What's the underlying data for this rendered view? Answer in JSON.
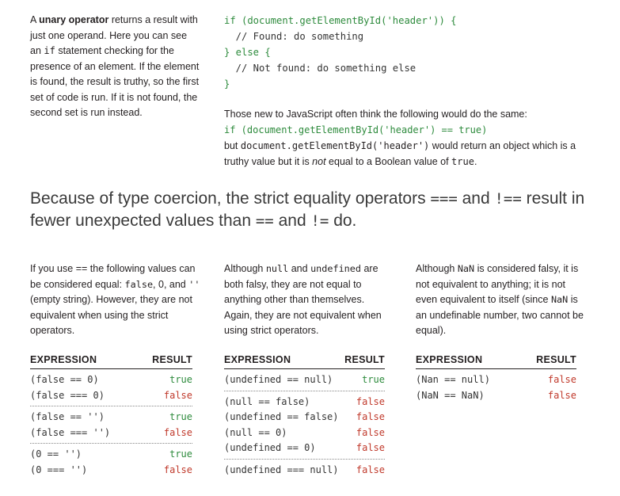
{
  "sidebar": {
    "p1": "A ",
    "bold": "unary operator",
    "p2": " returns a result with just one operand. Here you can see an ",
    "code": "if",
    "p3": " statement checking for the presence of an element. If the element is found, the result is truthy, so the first set of code is run. If it is not found, the second set is run instead."
  },
  "code": {
    "lines": [
      "if (document.getElementById('header')) {",
      "  // Found: do something",
      "} else {",
      "  // Not found: do something else",
      "}"
    ]
  },
  "explain": {
    "line1": "Those new to JavaScript often think the following would do the same:",
    "code1": "if (document.getElementById('header') == true)",
    "p1": "but ",
    "code2": "document.getElementById('header')",
    "p2": " would return an object which is a truthy value but it is ",
    "em": "not",
    "p3": " equal to a Boolean value of ",
    "code3": "true",
    "p4": "."
  },
  "headline": {
    "p1": "Because of type coercion, the strict equality operators ",
    "op1": "===",
    "p2": " and ",
    "op2": "!==",
    "p3": " result in fewer unexpected values than ",
    "op3": "==",
    "p4": " and ",
    "op4": "!=",
    "p5": " do."
  },
  "col1": {
    "p1": "If you use ",
    "op": "==",
    "p2": " the following values can be considered equal: ",
    "v1": "false",
    "p3": ", 0, and ",
    "v2": "''",
    "p4": " (empty string). However, they are not equivalent when using the strict operators."
  },
  "col2": {
    "p1": "Although ",
    "v1": "null",
    "p2": " and ",
    "v2": "undefined",
    "p3": " are both falsy, they are not equal to anything other than themselves. Again, they are not equivalent when using strict operators."
  },
  "col3": {
    "p1": "Although ",
    "v1": "NaN",
    "p2": " is considered falsy, it is not equivalent to anything; it is not even equivalent to itself (since ",
    "v2": "NaN",
    "p3": " is an undefinable number, two cannot be equal)."
  },
  "tables": {
    "header_expression": "EXPRESSION",
    "header_result": "RESULT",
    "t1": [
      [
        {
          "e": "(false == 0)",
          "r": "true"
        },
        {
          "e": "(false === 0)",
          "r": "false"
        }
      ],
      [
        {
          "e": "(false == '')",
          "r": "true"
        },
        {
          "e": "(false === '')",
          "r": "false"
        }
      ],
      [
        {
          "e": "(0 == '')",
          "r": "true"
        },
        {
          "e": "(0 === '')",
          "r": "false"
        }
      ]
    ],
    "t2": [
      [
        {
          "e": "(undefined == null)",
          "r": "true"
        }
      ],
      [
        {
          "e": "(null == false)",
          "r": "false"
        },
        {
          "e": "(undefined == false)",
          "r": "false"
        },
        {
          "e": "(null == 0)",
          "r": "false"
        },
        {
          "e": "(undefined == 0)",
          "r": "false"
        }
      ],
      [
        {
          "e": "(undefined === null)",
          "r": "false"
        }
      ]
    ],
    "t3": [
      [
        {
          "e": "(Nan == null)",
          "r": "false"
        },
        {
          "e": "(NaN == NaN)",
          "r": "false"
        }
      ]
    ]
  },
  "colors": {
    "green": "#2e8b3d",
    "red": "#c0392b",
    "text": "#231f20"
  }
}
